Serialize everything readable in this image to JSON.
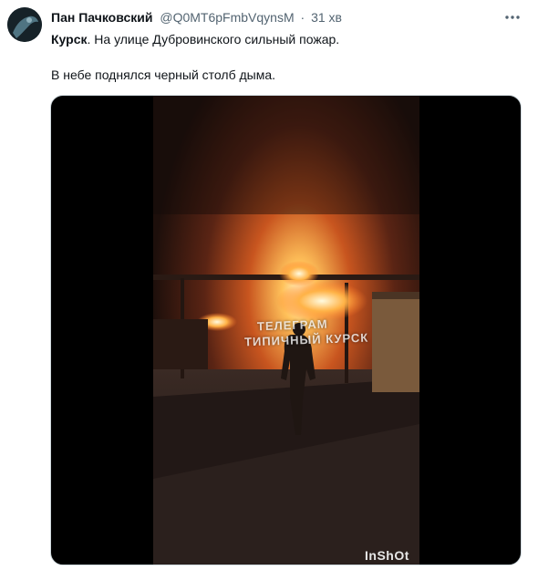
{
  "tweet": {
    "author_name": "Пан Пачковский",
    "author_handle": "@Q0MT6pFmbVqynsM",
    "separator": "·",
    "time": "31 хв",
    "text_bold": "Курск",
    "text_rest": ". На улице Дубровинского сильный пожар.",
    "text_line2": "В небе поднялся черный столб дыма."
  },
  "media": {
    "watermark_line1": "ТЕЛЕГРАМ",
    "watermark_line2": "ТИПИЧНЫЙ КУРСК",
    "app_watermark": "InShOt"
  },
  "icons": {
    "more": "more-horizontal-icon",
    "avatar": "avatar"
  },
  "colors": {
    "text": "#0f1419",
    "secondary": "#536471",
    "fire": "#ff9a3c"
  }
}
